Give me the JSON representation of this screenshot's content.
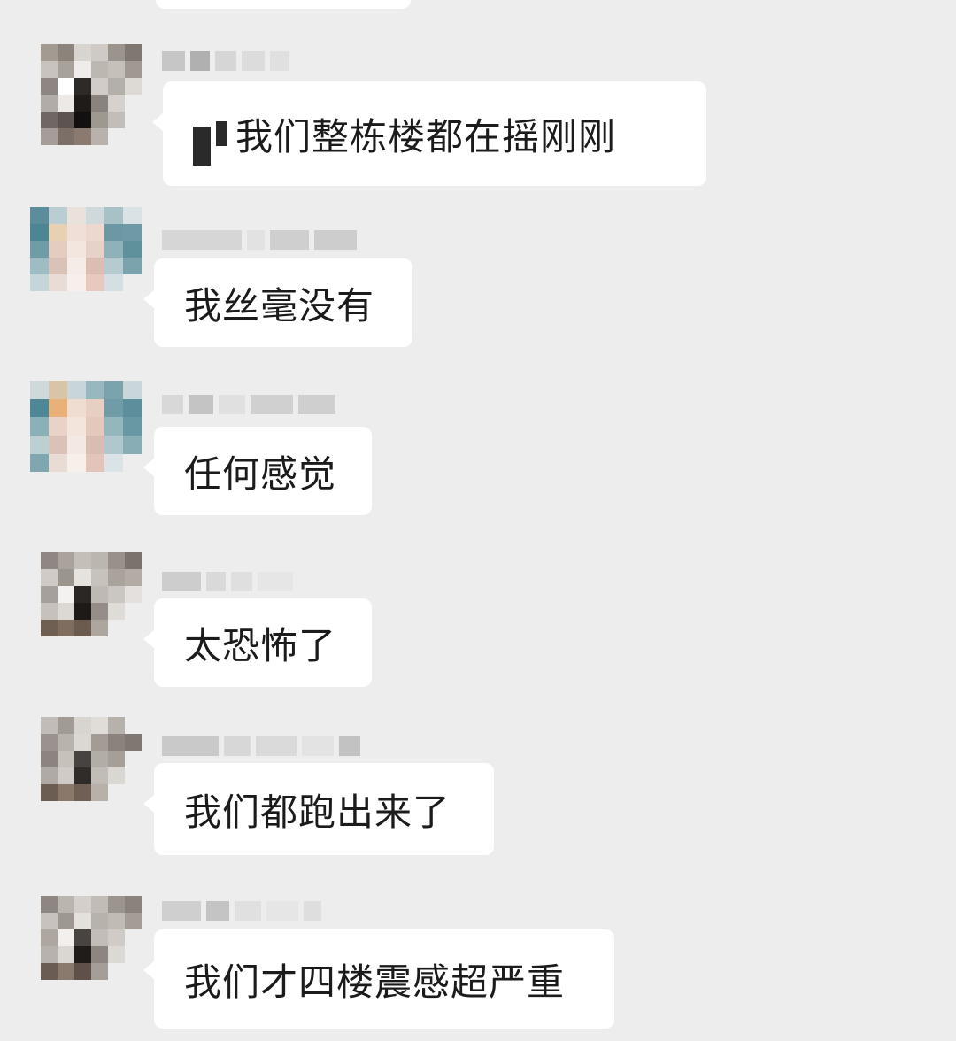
{
  "messages": [
    {
      "text": "我们整栋楼都在摇刚刚",
      "censored_prefix": true,
      "avatar": "pixelated-gray"
    },
    {
      "text": "我丝毫没有",
      "censored_prefix": false,
      "avatar": "pixelated-teal"
    },
    {
      "text": "任何感觉",
      "censored_prefix": false,
      "avatar": "pixelated-teal"
    },
    {
      "text": "太恐怖了",
      "censored_prefix": false,
      "avatar": "pixelated-gray"
    },
    {
      "text": "我们都跑出来了",
      "censored_prefix": false,
      "avatar": "pixelated-gray"
    },
    {
      "text": "我们才四楼震感超严重",
      "censored_prefix": false,
      "avatar": "pixelated-gray"
    }
  ],
  "colors": {
    "background": "#ededed",
    "bubble": "#ffffff",
    "text": "#1b1b1b"
  }
}
